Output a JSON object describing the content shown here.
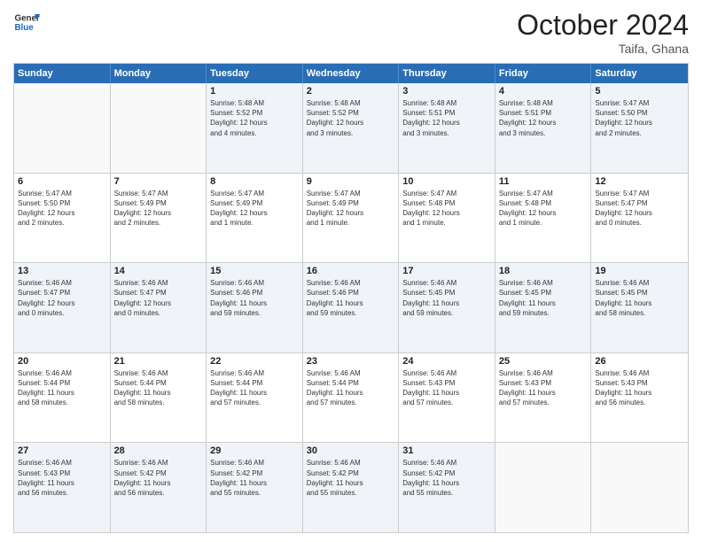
{
  "logo": {
    "line1": "General",
    "line2": "Blue"
  },
  "header": {
    "month": "October 2024",
    "location": "Taifa, Ghana"
  },
  "days": [
    "Sunday",
    "Monday",
    "Tuesday",
    "Wednesday",
    "Thursday",
    "Friday",
    "Saturday"
  ],
  "rows": [
    [
      {
        "day": "",
        "detail": ""
      },
      {
        "day": "",
        "detail": ""
      },
      {
        "day": "1",
        "detail": "Sunrise: 5:48 AM\nSunset: 5:52 PM\nDaylight: 12 hours\nand 4 minutes."
      },
      {
        "day": "2",
        "detail": "Sunrise: 5:48 AM\nSunset: 5:52 PM\nDaylight: 12 hours\nand 3 minutes."
      },
      {
        "day": "3",
        "detail": "Sunrise: 5:48 AM\nSunset: 5:51 PM\nDaylight: 12 hours\nand 3 minutes."
      },
      {
        "day": "4",
        "detail": "Sunrise: 5:48 AM\nSunset: 5:51 PM\nDaylight: 12 hours\nand 3 minutes."
      },
      {
        "day": "5",
        "detail": "Sunrise: 5:47 AM\nSunset: 5:50 PM\nDaylight: 12 hours\nand 2 minutes."
      }
    ],
    [
      {
        "day": "6",
        "detail": "Sunrise: 5:47 AM\nSunset: 5:50 PM\nDaylight: 12 hours\nand 2 minutes."
      },
      {
        "day": "7",
        "detail": "Sunrise: 5:47 AM\nSunset: 5:49 PM\nDaylight: 12 hours\nand 2 minutes."
      },
      {
        "day": "8",
        "detail": "Sunrise: 5:47 AM\nSunset: 5:49 PM\nDaylight: 12 hours\nand 1 minute."
      },
      {
        "day": "9",
        "detail": "Sunrise: 5:47 AM\nSunset: 5:49 PM\nDaylight: 12 hours\nand 1 minute."
      },
      {
        "day": "10",
        "detail": "Sunrise: 5:47 AM\nSunset: 5:48 PM\nDaylight: 12 hours\nand 1 minute."
      },
      {
        "day": "11",
        "detail": "Sunrise: 5:47 AM\nSunset: 5:48 PM\nDaylight: 12 hours\nand 1 minute."
      },
      {
        "day": "12",
        "detail": "Sunrise: 5:47 AM\nSunset: 5:47 PM\nDaylight: 12 hours\nand 0 minutes."
      }
    ],
    [
      {
        "day": "13",
        "detail": "Sunrise: 5:46 AM\nSunset: 5:47 PM\nDaylight: 12 hours\nand 0 minutes."
      },
      {
        "day": "14",
        "detail": "Sunrise: 5:46 AM\nSunset: 5:47 PM\nDaylight: 12 hours\nand 0 minutes."
      },
      {
        "day": "15",
        "detail": "Sunrise: 5:46 AM\nSunset: 5:46 PM\nDaylight: 11 hours\nand 59 minutes."
      },
      {
        "day": "16",
        "detail": "Sunrise: 5:46 AM\nSunset: 5:46 PM\nDaylight: 11 hours\nand 59 minutes."
      },
      {
        "day": "17",
        "detail": "Sunrise: 5:46 AM\nSunset: 5:45 PM\nDaylight: 11 hours\nand 59 minutes."
      },
      {
        "day": "18",
        "detail": "Sunrise: 5:46 AM\nSunset: 5:45 PM\nDaylight: 11 hours\nand 59 minutes."
      },
      {
        "day": "19",
        "detail": "Sunrise: 5:46 AM\nSunset: 5:45 PM\nDaylight: 11 hours\nand 58 minutes."
      }
    ],
    [
      {
        "day": "20",
        "detail": "Sunrise: 5:46 AM\nSunset: 5:44 PM\nDaylight: 11 hours\nand 58 minutes."
      },
      {
        "day": "21",
        "detail": "Sunrise: 5:46 AM\nSunset: 5:44 PM\nDaylight: 11 hours\nand 58 minutes."
      },
      {
        "day": "22",
        "detail": "Sunrise: 5:46 AM\nSunset: 5:44 PM\nDaylight: 11 hours\nand 57 minutes."
      },
      {
        "day": "23",
        "detail": "Sunrise: 5:46 AM\nSunset: 5:44 PM\nDaylight: 11 hours\nand 57 minutes."
      },
      {
        "day": "24",
        "detail": "Sunrise: 5:46 AM\nSunset: 5:43 PM\nDaylight: 11 hours\nand 57 minutes."
      },
      {
        "day": "25",
        "detail": "Sunrise: 5:46 AM\nSunset: 5:43 PM\nDaylight: 11 hours\nand 57 minutes."
      },
      {
        "day": "26",
        "detail": "Sunrise: 5:46 AM\nSunset: 5:43 PM\nDaylight: 11 hours\nand 56 minutes."
      }
    ],
    [
      {
        "day": "27",
        "detail": "Sunrise: 5:46 AM\nSunset: 5:43 PM\nDaylight: 11 hours\nand 56 minutes."
      },
      {
        "day": "28",
        "detail": "Sunrise: 5:46 AM\nSunset: 5:42 PM\nDaylight: 11 hours\nand 56 minutes."
      },
      {
        "day": "29",
        "detail": "Sunrise: 5:46 AM\nSunset: 5:42 PM\nDaylight: 11 hours\nand 55 minutes."
      },
      {
        "day": "30",
        "detail": "Sunrise: 5:46 AM\nSunset: 5:42 PM\nDaylight: 11 hours\nand 55 minutes."
      },
      {
        "day": "31",
        "detail": "Sunrise: 5:46 AM\nSunset: 5:42 PM\nDaylight: 11 hours\nand 55 minutes."
      },
      {
        "day": "",
        "detail": ""
      },
      {
        "day": "",
        "detail": ""
      }
    ]
  ],
  "alt_rows": [
    0,
    2,
    4
  ]
}
